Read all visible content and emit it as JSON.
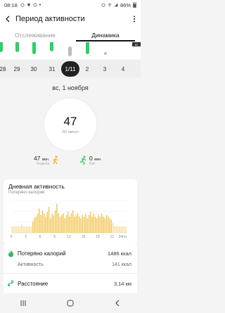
{
  "status": {
    "time": "08:18",
    "battery": "86%"
  },
  "appbar": {
    "title": "Период активности"
  },
  "tabs": [
    {
      "label": "Отслеживание",
      "active": false
    },
    {
      "label": "Динамика",
      "active": true
    }
  ],
  "activity_strip": {
    "goal_tag": "60"
  },
  "dates": [
    {
      "label": "28",
      "selected": false
    },
    {
      "label": "29",
      "selected": false
    },
    {
      "label": "30",
      "selected": false
    },
    {
      "label": "31",
      "selected": false
    },
    {
      "label": "1/11",
      "selected": true
    },
    {
      "label": "2",
      "selected": false
    },
    {
      "label": "3",
      "selected": false
    },
    {
      "label": "4",
      "selected": false
    }
  ],
  "day": {
    "heading": "вс, 1 ноября",
    "total_value": "47",
    "total_unit": "/60 минут",
    "walking": {
      "value": "47",
      "unit": "мин.",
      "label": "Ходьба"
    },
    "running": {
      "value": "0",
      "unit": "мин.",
      "label": "Бег"
    }
  },
  "daily_activity": {
    "title": "Дневная активность",
    "subtitle": "Потеряно калорий"
  },
  "chart_data": {
    "type": "bar",
    "title": "Дневная активность",
    "subtitle": "Потеряно калорий",
    "x_ticks": [
      "0",
      "3",
      "6",
      "9",
      "12",
      "15",
      "18",
      "21",
      "24(ч)"
    ],
    "x_range": [
      0,
      24
    ],
    "grid": true,
    "values": [
      0.2,
      0.2,
      0.2,
      0.2,
      0.2,
      0.2,
      0.25,
      0.2,
      0.2,
      0.2,
      0.2,
      0.2,
      0.2,
      0.35,
      0.45,
      0.5,
      0.6,
      0.75,
      0.55,
      0.7,
      0.6,
      0.5,
      0.65,
      0.8,
      0.45,
      0.6,
      0.55,
      0.7,
      0.9,
      0.6,
      0.5,
      0.55,
      0.6,
      0.45,
      0.55,
      0.65,
      0.5,
      0.6,
      0.7,
      0.5,
      0.55,
      0.6,
      0.5,
      0.45,
      0.55,
      0.5,
      0.6,
      0.45,
      0.55,
      0.65,
      0.5,
      0.6,
      0.5,
      0.45,
      0.55,
      0.5,
      0.6,
      0.5,
      0.45,
      0.55,
      0.5,
      0.45,
      0.4,
      0.3,
      0.2,
      0.2,
      0.2,
      0.2,
      0.2,
      0.2,
      0.2,
      0.2
    ]
  },
  "stats": {
    "calories": {
      "label": "Потеряно калорий",
      "value": "1486 ккал",
      "color": "#36b765"
    },
    "active": {
      "label": "Активность",
      "value": "141 ккал"
    },
    "distance": {
      "label": "Расстояние",
      "value": "3,14 км",
      "color": "#36b765"
    }
  },
  "colors": {
    "accent_green": "#2ecf67",
    "chart_bar": "#f2c24b",
    "chart_bar_light": "#f8dd99"
  }
}
